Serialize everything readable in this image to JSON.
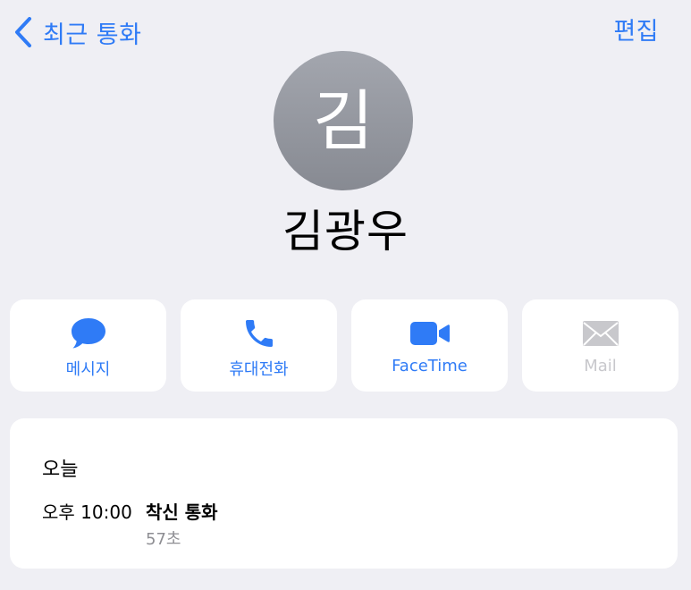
{
  "nav": {
    "back_label": "최근 통화",
    "edit_label": "편집"
  },
  "contact": {
    "initial": "김",
    "name": "김광우"
  },
  "actions": [
    {
      "label": "메시지",
      "icon": "message-bubble-icon",
      "enabled": true
    },
    {
      "label": "휴대전화",
      "icon": "phone-icon",
      "enabled": true
    },
    {
      "label": "FaceTime",
      "icon": "video-camera-icon",
      "enabled": true
    },
    {
      "label": "Mail",
      "icon": "envelope-icon",
      "enabled": false
    }
  ],
  "history": {
    "date": "오늘",
    "entries": [
      {
        "time": "오후 10:00",
        "type": "착신 통화",
        "duration": "57초"
      }
    ]
  },
  "colors": {
    "accent": "#2f7bf6",
    "disabled": "#c8c8cc",
    "background": "#efeff4",
    "avatar_top": "#a3a6ae",
    "avatar_bottom": "#878a92",
    "secondary_text": "#8e8e93"
  }
}
